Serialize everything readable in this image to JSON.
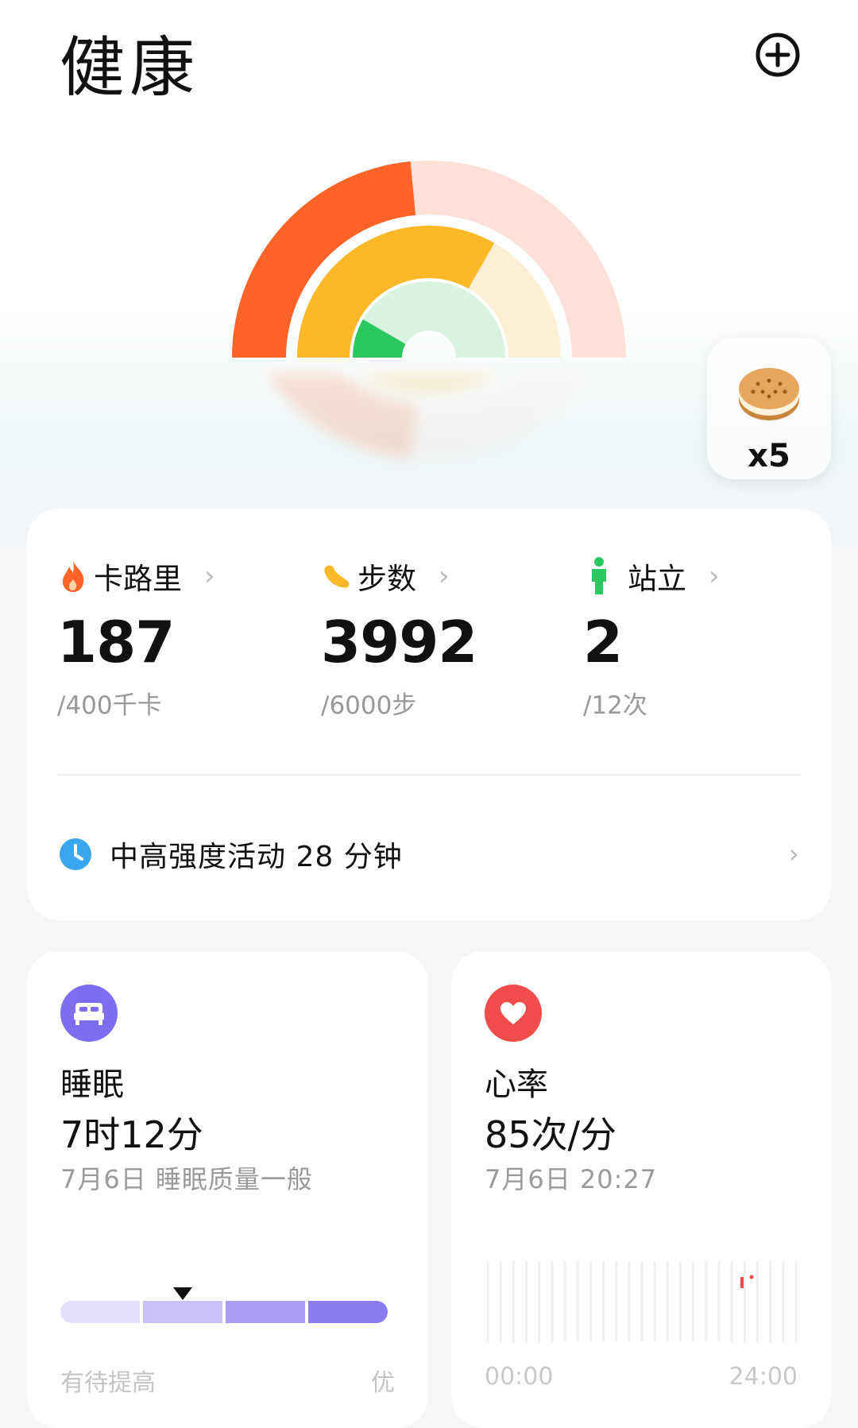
{
  "header": {
    "title": "健康"
  },
  "reward": {
    "count": "x5"
  },
  "metrics": [
    {
      "label": "卡路里",
      "value": "187",
      "goal": "/400千卡",
      "progress": 0.47
    },
    {
      "label": "步数",
      "value": "3992",
      "goal": "/6000步",
      "progress": 0.665
    },
    {
      "label": "站立",
      "value": "2",
      "goal": "/12次",
      "progress": 0.167
    }
  ],
  "intensity": {
    "text": "中高强度活动 28 分钟"
  },
  "sleep": {
    "title": "睡眠",
    "value": "7时12分",
    "subtitle": "7月6日 睡眠质量一般",
    "scale_low": "有待提高",
    "scale_high": "优",
    "quality_segment": 2
  },
  "heart": {
    "title": "心率",
    "value": "85次/分",
    "subtitle": "7月6日 20:27",
    "axis_start": "00:00",
    "axis_end": "24:00"
  },
  "colors": {
    "calorie": "#fe6328",
    "calorie_track": "#fde0d8",
    "steps": "#fdb827",
    "steps_track": "#fdefd3",
    "stand": "#2bc862",
    "stand_track": "#d8f4e1",
    "sleep": "#7d6df0",
    "heart": "#f04c4c",
    "intensity": "#3aa6f0"
  }
}
